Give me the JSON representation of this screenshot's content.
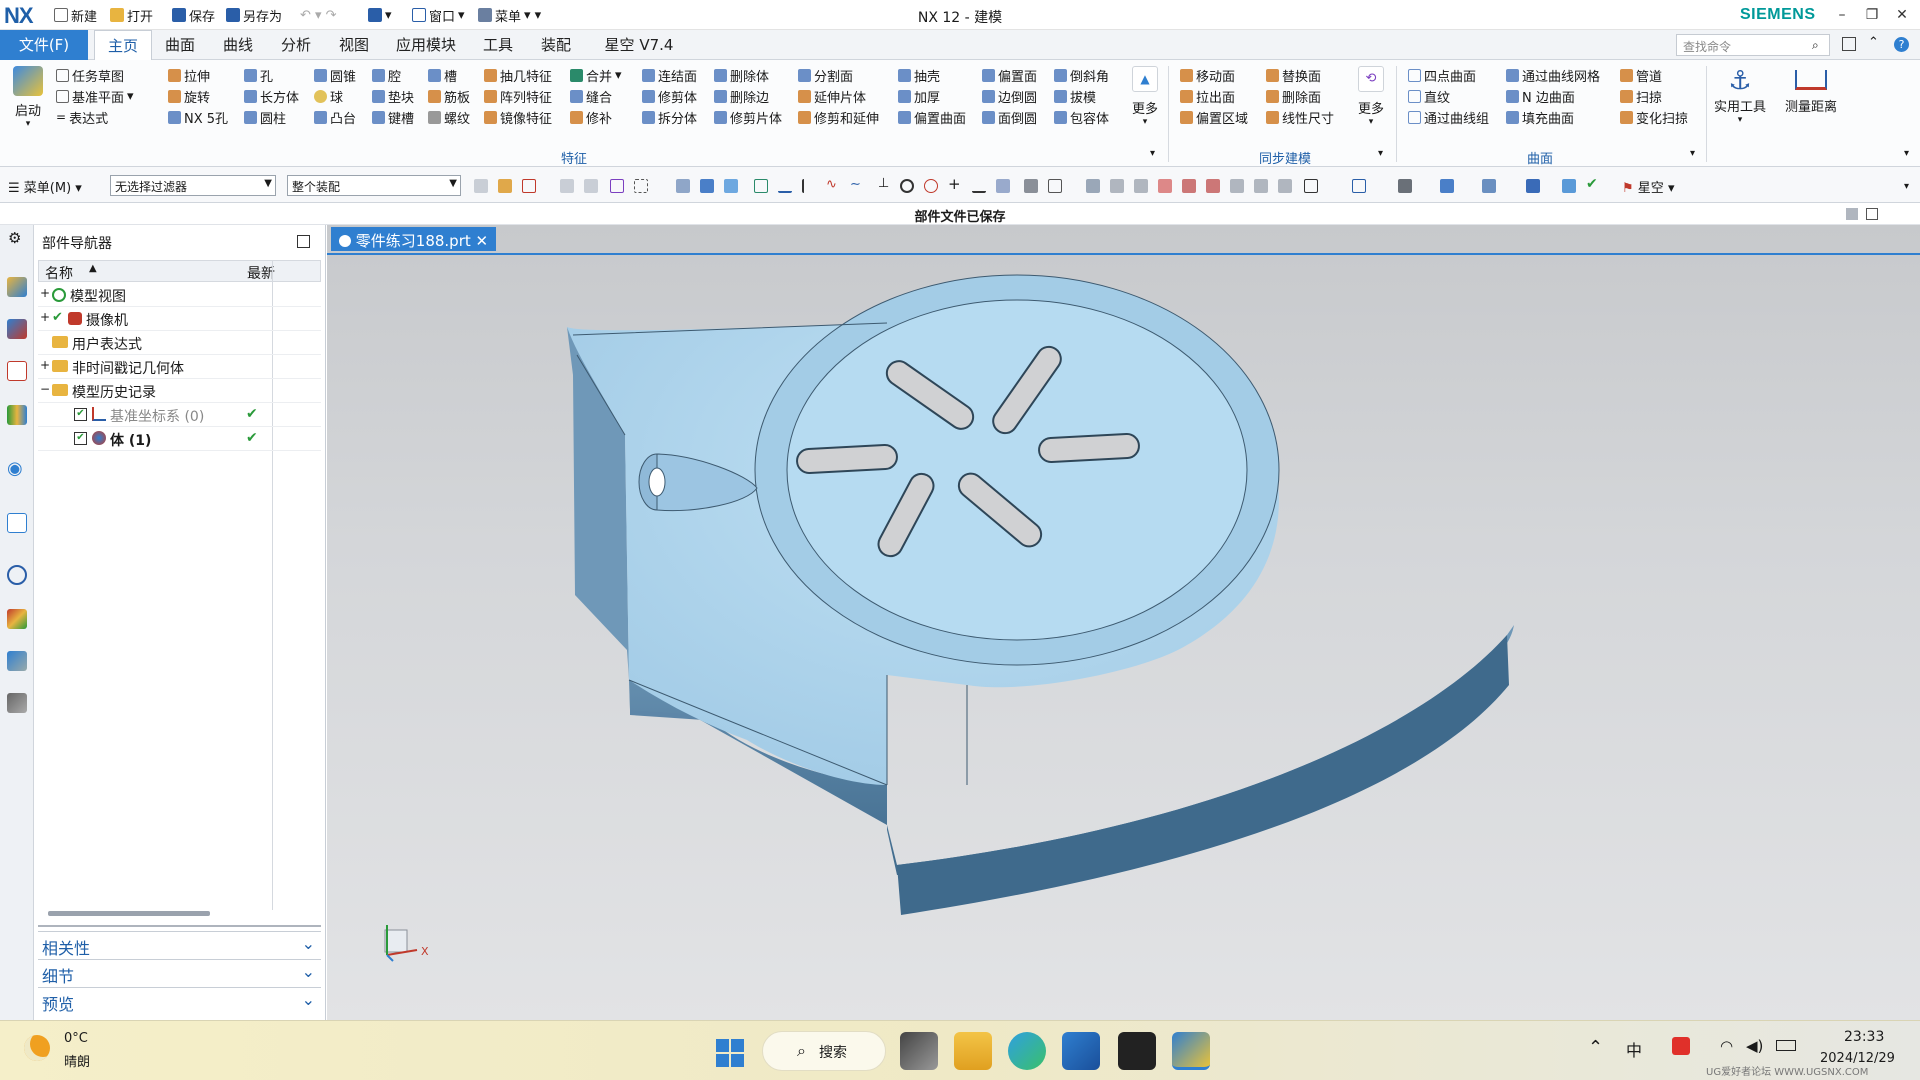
{
  "titlebar": {
    "logo": "NX",
    "quick_access": [
      "新建",
      "打开",
      "保存",
      "另存为",
      "窗口",
      "菜单"
    ],
    "title": "NX 12 - 建模",
    "brand": "SIEMENS"
  },
  "menubar": {
    "file_tab": "文件(F)",
    "tabs": [
      "主页",
      "曲面",
      "曲线",
      "分析",
      "视图",
      "应用模块",
      "工具",
      "装配",
      "星空 V7.4"
    ],
    "active_tab": "主页",
    "search_placeholder": "查找命令"
  },
  "ribbon": {
    "launch": "启动",
    "sketch_col": [
      "任务草图",
      "基准平面",
      "表达式"
    ],
    "col_a": [
      "拉伸",
      "旋转",
      "NX 5孔"
    ],
    "col_b": [
      "孔",
      "长方体",
      "圆柱"
    ],
    "col_c": [
      "圆锥",
      "球",
      "凸台"
    ],
    "col_d": [
      "腔",
      "垫块",
      "键槽"
    ],
    "col_e": [
      "槽",
      "筋板",
      "螺纹"
    ],
    "col_f": [
      "抽几特征",
      "阵列特征",
      "镜像特征"
    ],
    "col_g": [
      "合并",
      "缝合",
      "修补"
    ],
    "col_h": [
      "连结面",
      "修剪体",
      "拆分体"
    ],
    "col_i": [
      "删除体",
      "删除边",
      "修剪片体"
    ],
    "col_j": [
      "分割面",
      "延伸片体",
      "修剪和延伸"
    ],
    "col_k": [
      "抽壳",
      "加厚",
      "偏置曲面"
    ],
    "col_l": [
      "偏置面",
      "边倒圆",
      "面倒圆"
    ],
    "col_m": [
      "倒斜角",
      "拔模",
      "包容体"
    ],
    "more": "更多",
    "features_label": "特征",
    "sync_col1": [
      "移动面",
      "拉出面",
      "偏置区域"
    ],
    "sync_col2": [
      "替换面",
      "删除面",
      "线性尺寸"
    ],
    "sync_more": "更多",
    "sync_label": "同步建模",
    "surf_col1": [
      "四点曲面",
      "直纹",
      "通过曲线组"
    ],
    "surf_col2": [
      "通过曲线网格",
      "N 边曲面",
      "填充曲面"
    ],
    "surf_col3": [
      "管道",
      "扫掠",
      "变化扫掠"
    ],
    "surface_label": "曲面",
    "utility": "实用工具",
    "measure": "测量距离"
  },
  "selbar": {
    "menu": "菜单(M)",
    "filter": "无选择过滤器",
    "scope": "整个装配",
    "xingkong": "星空"
  },
  "status": "部件文件已保存",
  "navigator": {
    "title": "部件导航器",
    "col_name": "名称",
    "col_latest": "最新",
    "rows": [
      {
        "label": "模型视图",
        "latest": ""
      },
      {
        "label": "摄像机",
        "latest": ""
      },
      {
        "label": "用户表达式",
        "latest": ""
      },
      {
        "label": "非时间戳记几何体",
        "latest": ""
      },
      {
        "label": "模型历史记录",
        "latest": ""
      },
      {
        "label": "基准坐标系 (0)",
        "latest": "✔"
      },
      {
        "label": "体 (1)",
        "latest": "✔"
      }
    ],
    "panels": [
      "相关性",
      "细节",
      "预览"
    ]
  },
  "graphics": {
    "tab": "零件练习188.prt",
    "axis_x": "X",
    "part_color": "#a9d0ea"
  },
  "taskbar": {
    "weather_temp": "0°C",
    "weather_desc": "晴朗",
    "search": "搜索",
    "ime": "中",
    "time": "23:33",
    "date": "2024/12/29",
    "watermark": "UG爱好者论坛 WWW.UGSNX.COM"
  }
}
